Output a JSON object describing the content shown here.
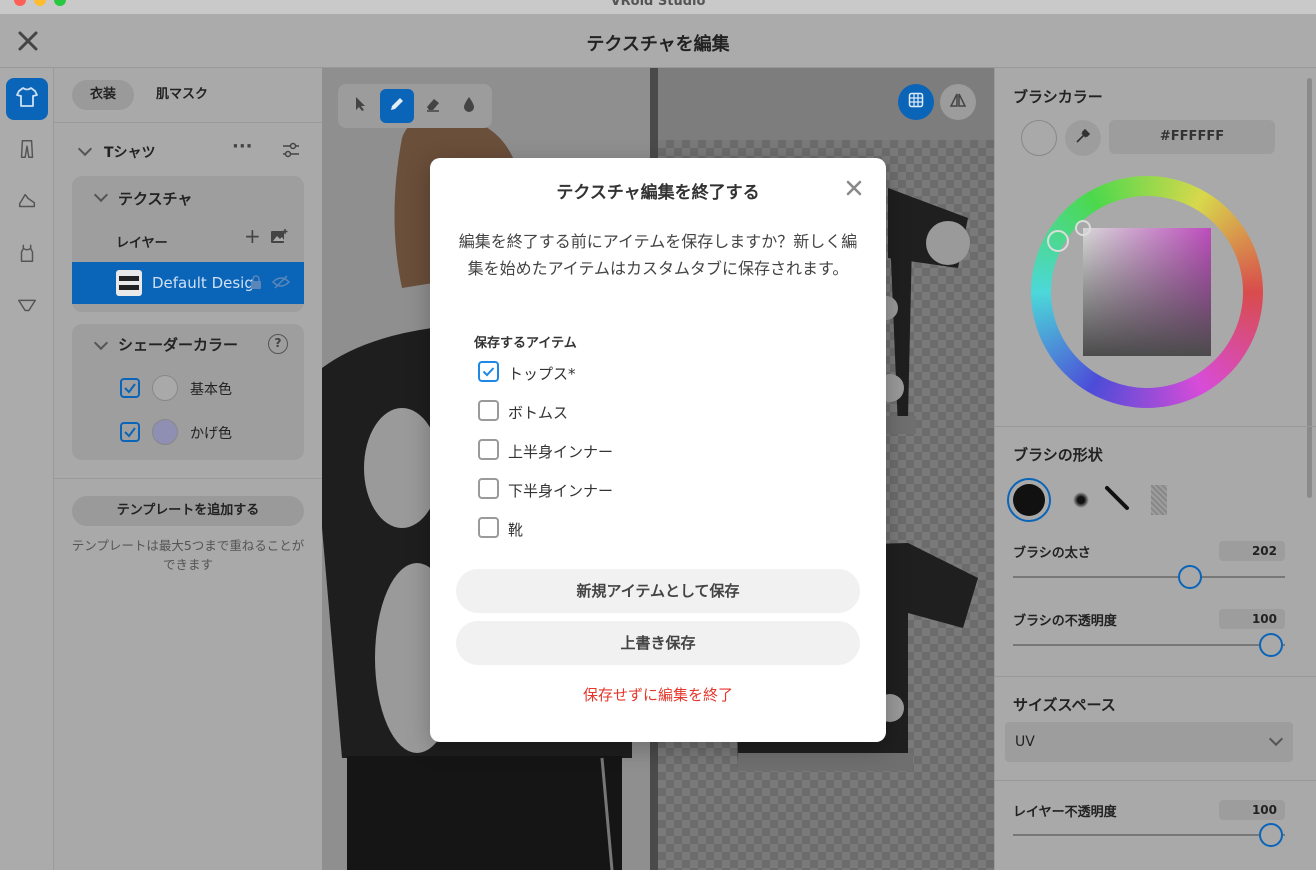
{
  "window": {
    "app_title": "VRoid Studio"
  },
  "header": {
    "title": "テクスチャを編集"
  },
  "rail": {
    "items": [
      {
        "icon": "shirt-icon"
      },
      {
        "icon": "pants-icon"
      },
      {
        "icon": "shoe-icon"
      },
      {
        "icon": "tank-top-icon"
      },
      {
        "icon": "underwear-icon"
      }
    ]
  },
  "left": {
    "tabs": [
      "衣装",
      "肌マスク"
    ],
    "item_name": "Tシャツ",
    "texture_label": "テクスチャ",
    "layer_label": "レイヤー",
    "layer_name": "Default Desig",
    "shader_label": "シェーダーカラー",
    "shader_colors": [
      {
        "label": "基本色",
        "color": "#a9a9a9"
      },
      {
        "label": "かげ色",
        "color": "#8e8fb3"
      }
    ],
    "add_template": "テンプレートを追加する",
    "template_note": "テンプレートは最大5つまで重ねることができます"
  },
  "right": {
    "brush_color_title": "ブラシカラー",
    "hex": "#FFFFFF",
    "brush_shape_title": "ブラシの形状",
    "brush_size_label": "ブラシの太さ",
    "brush_size": "202",
    "brush_opacity_label": "ブラシの不透明度",
    "brush_opacity": "100",
    "size_space_title": "サイズスペース",
    "size_space_value": "UV",
    "layer_opacity_label": "レイヤー不透明度",
    "layer_opacity": "100"
  },
  "modal": {
    "title": "テクスチャ編集を終了する",
    "message": "編集を終了する前にアイテムを保存しますか？新しく編集を始めたアイテムはカスタムタブに保存されます。",
    "items_label": "保存するアイテム",
    "items": [
      {
        "label": "トップス*",
        "checked": true
      },
      {
        "label": "ボトムス",
        "checked": false
      },
      {
        "label": "上半身インナー",
        "checked": false
      },
      {
        "label": "下半身インナー",
        "checked": false
      },
      {
        "label": "靴",
        "checked": false
      }
    ],
    "save_new": "新規アイテムとして保存",
    "overwrite": "上書き保存",
    "discard": "保存せずに編集を終了"
  },
  "colors": {
    "accent": "#0a64b8",
    "danger": "#e5372b"
  }
}
